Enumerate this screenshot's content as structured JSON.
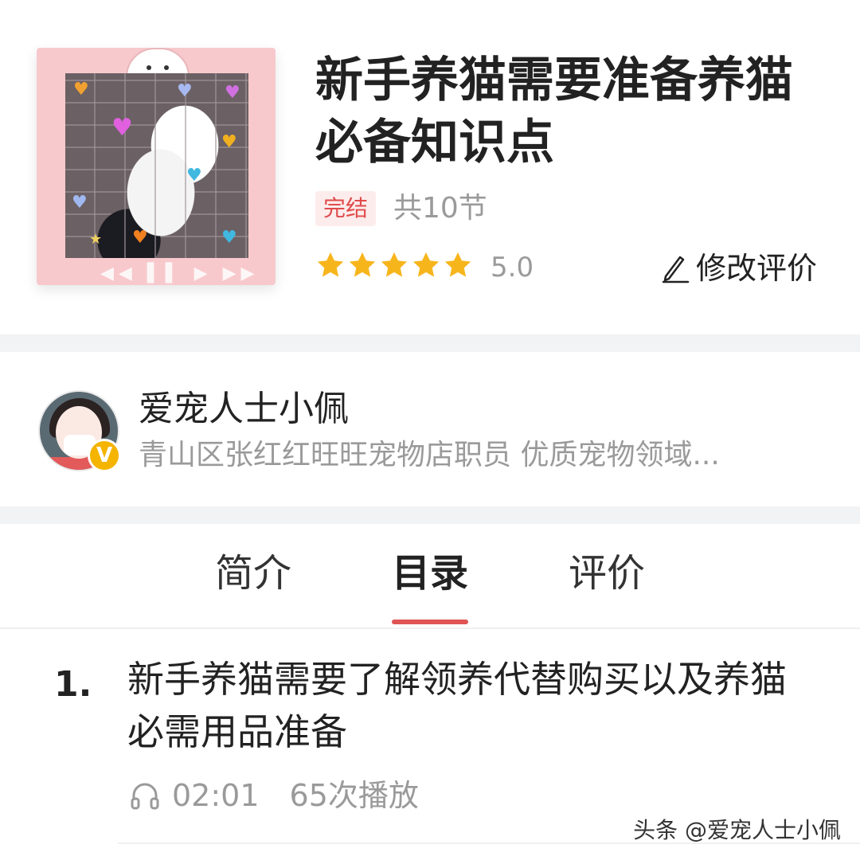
{
  "course": {
    "title": "新手养猫需要准备养猫必备知识点",
    "status_badge": "完结",
    "lesson_count": "共10节",
    "rating": 5.0,
    "rating_text": "5.0",
    "stars_total": 5,
    "edit_review_label": "修改评价"
  },
  "author": {
    "name": "爱宠人士小佩",
    "description": "青山区张红红旺旺宠物店职员 优质宠物领域...",
    "verified_badge": "V"
  },
  "tabs": [
    {
      "label": "简介",
      "active": false
    },
    {
      "label": "目录",
      "active": true
    },
    {
      "label": "评价",
      "active": false
    }
  ],
  "episodes": [
    {
      "index": "1.",
      "title": "新手养猫需要了解领养代替购买以及养猫必需用品准备",
      "duration": "02:01",
      "plays": "65次播放"
    }
  ],
  "watermark": "头条 @爱宠人士小佩",
  "colors": {
    "accent_red": "#e05454",
    "star_yellow": "#f7b51c",
    "muted_gray": "#9a9a9a",
    "cover_pink": "#f8c9cc"
  }
}
